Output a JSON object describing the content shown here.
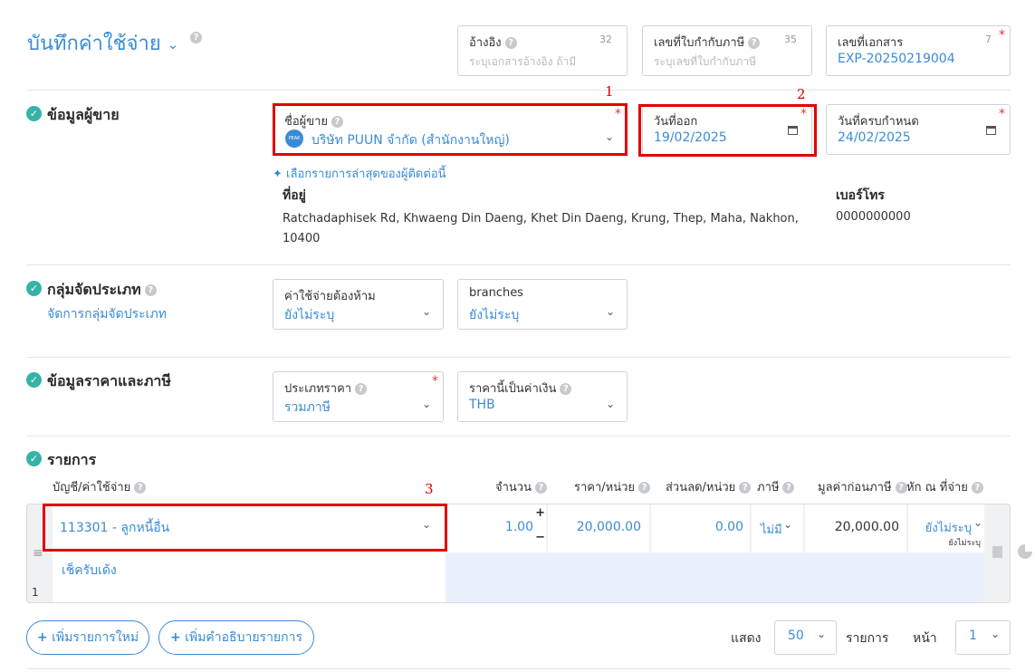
{
  "header": {
    "title": "บันทึกค่าใช้จ่าย",
    "fields": [
      {
        "label": "อ้างอิง",
        "placeholder": "ระบุเอกสารอ้างอิง ถ้ามี",
        "count": "32"
      },
      {
        "label": "เลขที่ใบกำกับภาษี",
        "placeholder": "ระบุเลขที่ใบกำกับภาษี",
        "count": "35"
      },
      {
        "label": "เลขที่เอกสาร",
        "value": "EXP-20250219004",
        "count": "7"
      }
    ]
  },
  "seller": {
    "section_title": "ข้อมูลผู้ขาย",
    "name_label": "ชื่อผู้ขาย",
    "name_value": "บริษัท PUUN จำกัด (สำนักงานใหญ่)",
    "logo_text": "PEAK",
    "issue_date_label": "วันที่ออก",
    "issue_date": "19/02/2025",
    "due_date_label": "วันที่ครบกำหนด",
    "due_date": "24/02/2025",
    "pick_recent": "เลือกรายการล่าสุดของผู้ติดต่อนี้",
    "address_label": "ที่อยู่",
    "address_line1": "Ratchadaphisek Rd, Khwaeng Din Daeng, Khet Din Daeng, Krung, Thep, Maha, Nakhon,",
    "address_line2": "10400",
    "phone_label": "เบอร์โทร",
    "phone": "0000000000"
  },
  "category": {
    "section_title": "กลุ่มจัดประเภท",
    "manage_link": "จัดการกลุ่มจัดประเภท",
    "field1_label": "ค่าใช้จ่ายต้องห้าม",
    "field1_value": "ยังไม่ระบุ",
    "field2_label": "branches",
    "field2_value": "ยังไม่ระบุ"
  },
  "pricing": {
    "section_title": "ข้อมูลราคาและภาษี",
    "price_type_label": "ประเภทราคา",
    "price_type_value": "รวมภาษี",
    "currency_label": "ราคานี้เป็นค่าเงิน",
    "currency_value": "THB"
  },
  "items": {
    "section_title": "รายการ",
    "columns": {
      "account": "บัญชี/ค่าใช้จ่าย",
      "qty": "จำนวน",
      "price": "ราคา/หน่วย",
      "discount": "ส่วนลด/หน่วย",
      "tax": "ภาษี",
      "pretax": "มูลค่าก่อนภาษี",
      "withhold": "หัก ณ ที่จ่าย"
    },
    "row": {
      "index": "1",
      "account": "113301 - ลูกหนี้อื่น",
      "description": "เช็ครับเด้ง",
      "qty": "1.00",
      "price": "20,000.00",
      "discount": "0.00",
      "tax": "ไม่มี",
      "pretax": "20,000.00",
      "withhold": "ยังไม่ระบุ",
      "withhold_sub": "ยังไม่ระบุ"
    },
    "add_item": "เพิ่มรายการใหม่",
    "add_desc": "เพิ่มคำอธิบายรายการ",
    "show_label": "แสดง",
    "page_size": "50",
    "items_label": "รายการ",
    "page_label": "หน้า",
    "page": "1"
  },
  "annotations": [
    "1",
    "2",
    "3"
  ],
  "colors": {
    "accent": "#3a8bd6",
    "check": "#36b3a8",
    "annotation": "#e10000",
    "required": "#e53935"
  }
}
